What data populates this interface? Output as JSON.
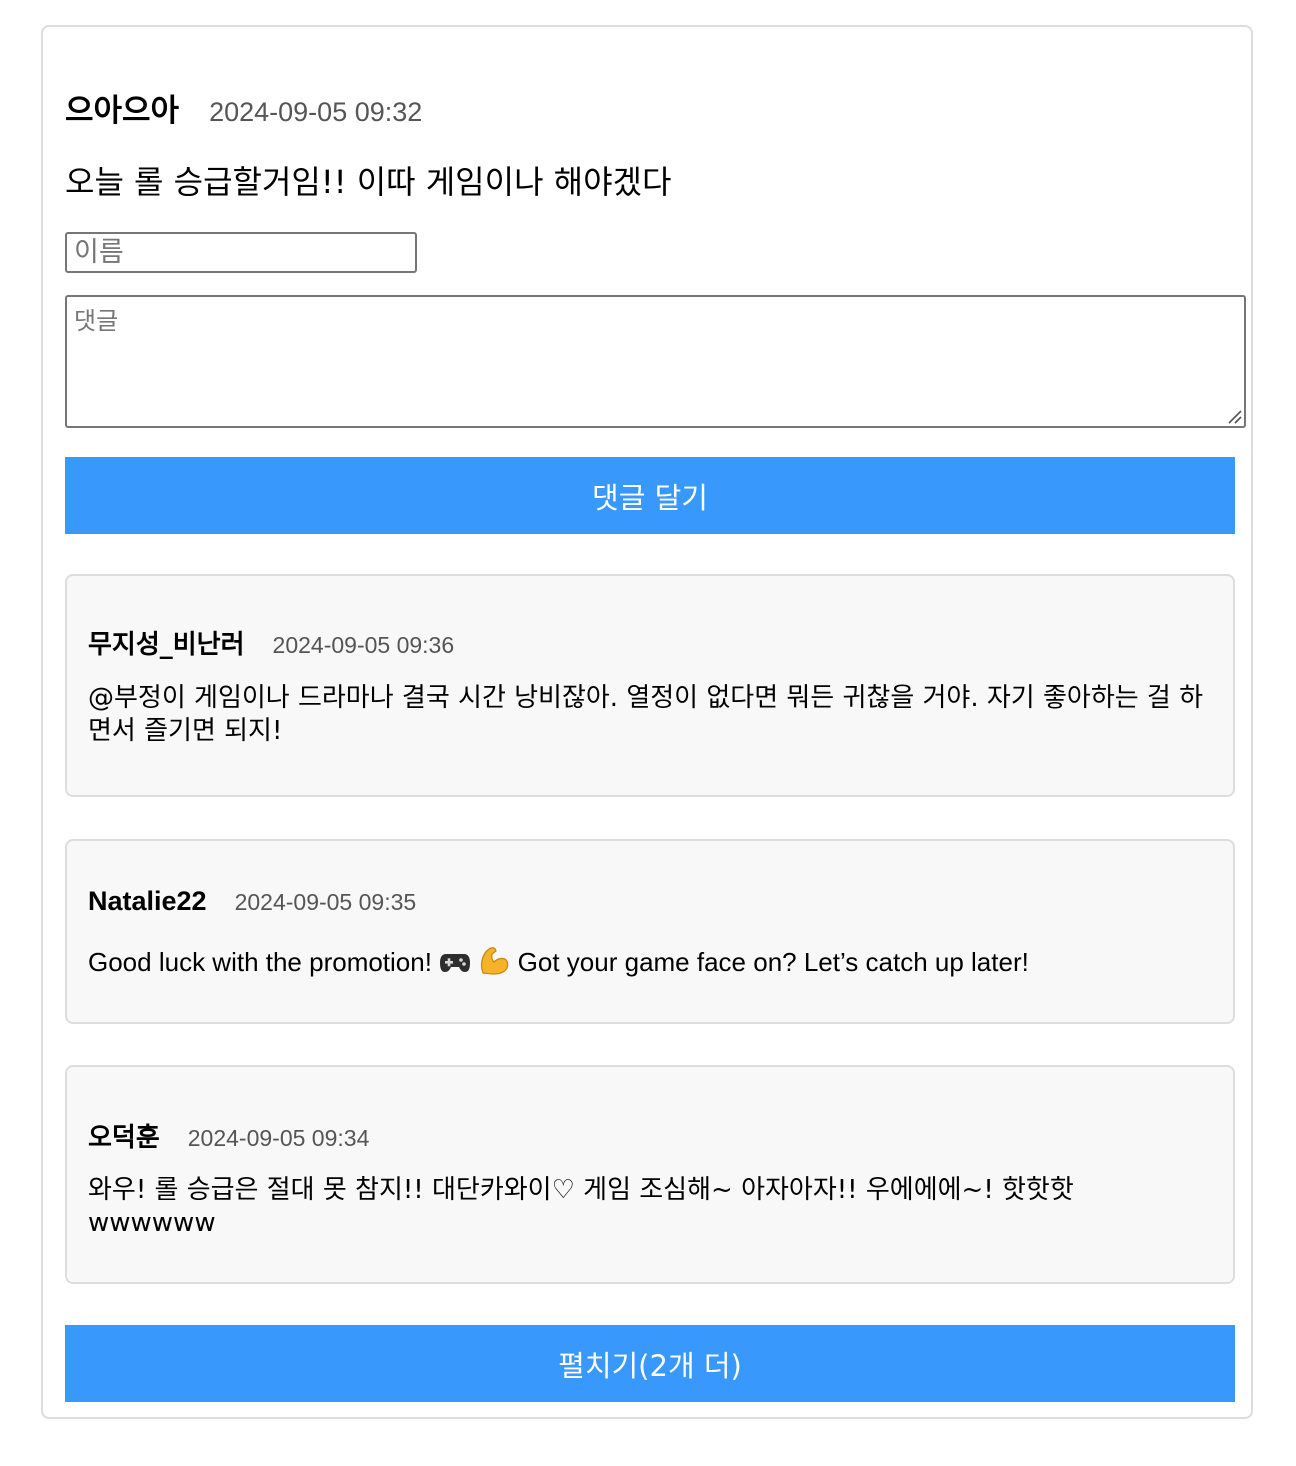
{
  "post": {
    "author": "으아으아",
    "timestamp": "2024-09-05 09:32",
    "content": "오늘 롤 승급할거임!! 이따 게임이나 해야겠다"
  },
  "form": {
    "name_placeholder": "이름",
    "comment_placeholder": "댓글",
    "submit_label": "댓글 달기"
  },
  "comments": [
    {
      "author": "무지성_비난러",
      "timestamp": "2024-09-05 09:36",
      "content": "@부정이 게임이나 드라마나 결국 시간 낭비잖아. 열정이 없다면 뭐든 귀찮을 거야. 자기 좋아하는 걸 하면서 즐기면 되지!"
    },
    {
      "author": "Natalie22",
      "timestamp": "2024-09-05 09:35",
      "content_before": "Good luck with the promotion!",
      "content_after": "Got your game face on? Let’s catch up later!",
      "icons": [
        "game-controller-icon",
        "flexed-biceps-icon"
      ]
    },
    {
      "author": "오덕훈",
      "timestamp": "2024-09-05 09:34",
      "content": "와우! 롤 승급은 절대 못 참지!! 대단카와이♡ 게임 조심해~ 아자아자!! 우에에에~! 핫핫핫 wwwwww"
    }
  ],
  "expand_label": "펼치기(2개 더)",
  "colors": {
    "button_bg": "#3898fc",
    "button_text": "#ffffff",
    "card_border": "#dddddd",
    "comment_bg": "#f8f8f8",
    "timestamp": "#555555"
  }
}
